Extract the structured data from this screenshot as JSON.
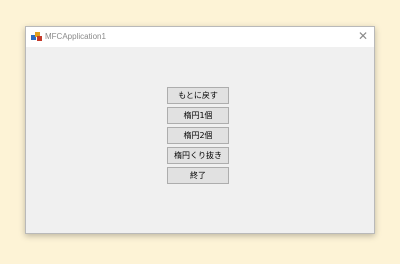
{
  "window": {
    "title": "MFCApplication1",
    "close_glyph": "✕",
    "app_icon": "mfc-app-icon"
  },
  "buttons": [
    {
      "label": "もとに戻す"
    },
    {
      "label": "楕円1個"
    },
    {
      "label": "楕円2個"
    },
    {
      "label": "楕円くり抜き"
    },
    {
      "label": "終了"
    }
  ],
  "colors": {
    "desktop": "#fdf3d6",
    "window_bg": "#f0f0f0",
    "button_bg": "#e1e1e1",
    "button_border": "#adadad"
  }
}
